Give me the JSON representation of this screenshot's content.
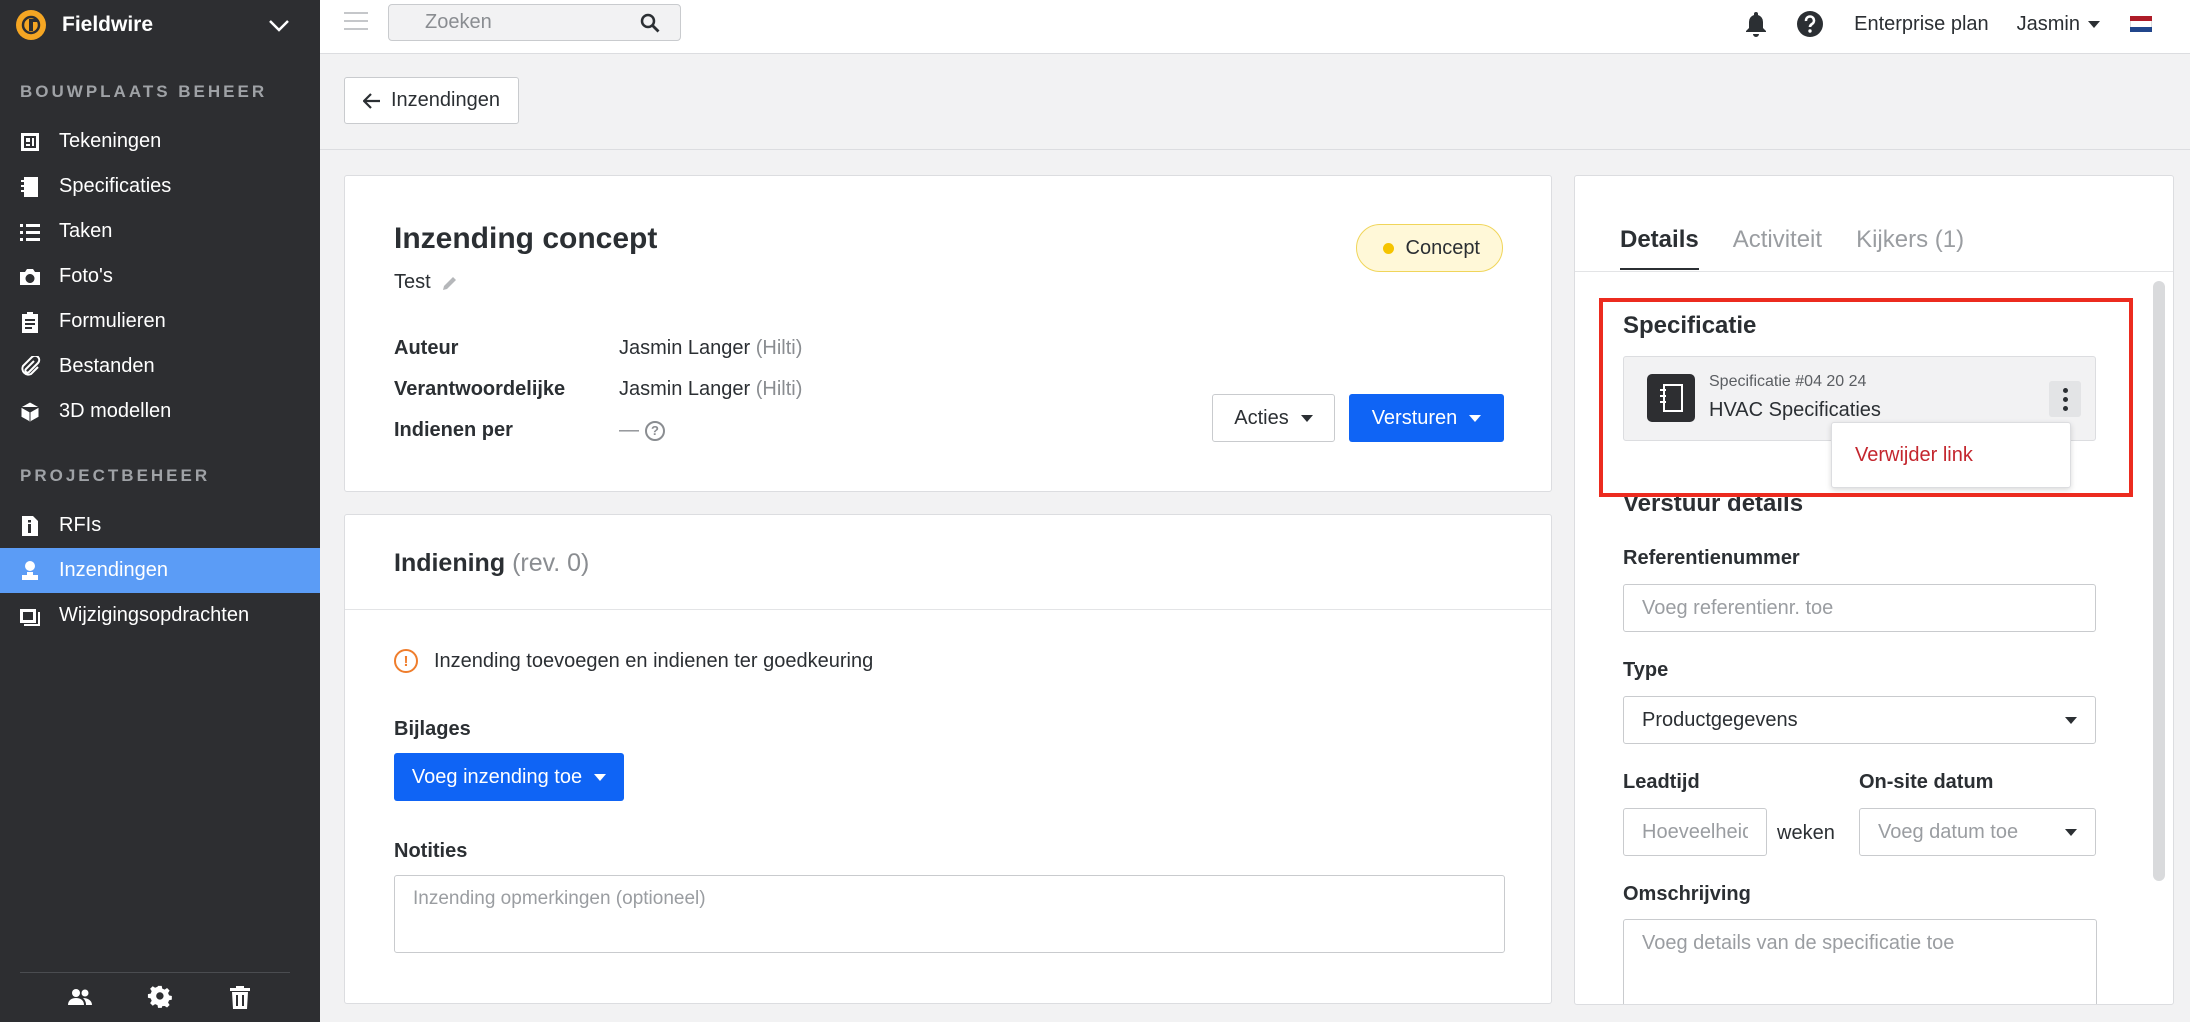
{
  "app": {
    "brand": "Fieldwire"
  },
  "sidebar": {
    "section1": "BOUWPLAATS BEHEER",
    "items1": [
      {
        "label": "Tekeningen",
        "icon": "drawings-icon"
      },
      {
        "label": "Specificaties",
        "icon": "specs-icon"
      },
      {
        "label": "Taken",
        "icon": "tasks-icon"
      },
      {
        "label": "Foto's",
        "icon": "camera-icon"
      },
      {
        "label": "Formulieren",
        "icon": "clipboard-icon"
      },
      {
        "label": "Bestanden",
        "icon": "paperclip-icon"
      },
      {
        "label": "3D modellen",
        "icon": "cube-icon"
      }
    ],
    "section2": "PROJECTBEHEER",
    "items2": [
      {
        "label": "RFIs",
        "icon": "rfi-icon"
      },
      {
        "label": "Inzendingen",
        "icon": "submittal-icon",
        "active": true
      },
      {
        "label": "Wijzigingsopdrachten",
        "icon": "change-order-icon"
      }
    ],
    "bottom_icons": [
      "team-icon",
      "gear-icon",
      "trash-icon"
    ]
  },
  "topbar": {
    "search_placeholder": "Zoeken",
    "plan": "Enterprise plan",
    "user": "Jasmin",
    "flag_colors": [
      "#ae1c28",
      "#ffffff",
      "#21468b"
    ]
  },
  "back": {
    "label": "Inzendingen"
  },
  "submittal": {
    "title": "Inzending concept",
    "subtitle": "Test",
    "status": "Concept",
    "meta": [
      {
        "key": "Auteur",
        "value": "Jasmin Langer",
        "org": "(Hilti)"
      },
      {
        "key": "Verantwoordelijke",
        "value": "Jasmin Langer",
        "org": "(Hilti)"
      },
      {
        "key": "Indienen per",
        "value": "—"
      }
    ],
    "actions_label": "Acties",
    "send_label": "Versturen"
  },
  "indiening": {
    "title": "Indiening",
    "rev": "(rev. 0)",
    "warning": "Inzending toevoegen en indienen ter goedkeuring",
    "attachments_label": "Bijlages",
    "add_label": "Voeg inzending toe",
    "notes_label": "Notities",
    "notes_placeholder": "Inzending opmerkingen (optioneel)"
  },
  "panel": {
    "tabs": [
      {
        "label": "Details",
        "active": true
      },
      {
        "label": "Activiteit"
      },
      {
        "label": "Kijkers (1)"
      }
    ],
    "spec_section": "Specificatie",
    "spec_number": "Specificatie #04 20 24",
    "spec_name": "HVAC Specificaties",
    "remove_link": "Verwijder link",
    "send_details": "Verstuur details",
    "ref_label": "Referentienummer",
    "ref_placeholder": "Voeg referentienr. toe",
    "type_label": "Type",
    "type_value": "Productgegevens",
    "lead_label": "Leadtijd",
    "lead_placeholder": "Hoeveelheid",
    "weeks": "weken",
    "onsite_label": "On-site datum",
    "onsite_placeholder": "Voeg datum toe",
    "desc_label": "Omschrijving",
    "desc_placeholder": "Voeg details van de specificatie toe"
  },
  "colors": {
    "primary": "#0f64f5",
    "sidebar_bg": "#2d2e31",
    "active_nav": "#5b9cf6",
    "highlight": "#ec2b1f",
    "danger": "#c4262e",
    "concept_dot": "#f5c400"
  }
}
